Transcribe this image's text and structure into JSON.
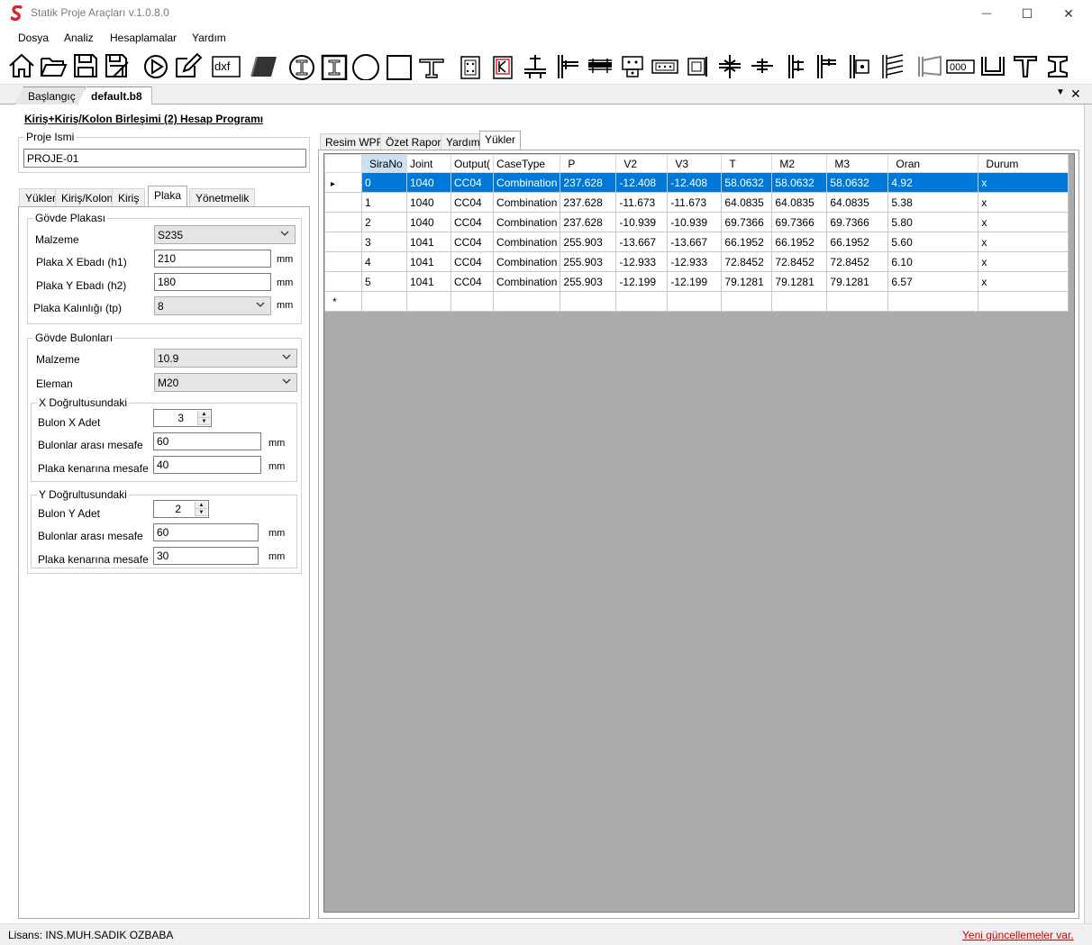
{
  "app": {
    "title": "Statik Proje Araçları v.1.0.8.0"
  },
  "menu": [
    "Dosya",
    "Analiz",
    "Hesaplamalar",
    "Yardım"
  ],
  "doc_tabs": [
    {
      "label": "Başlangıç"
    },
    {
      "label": "default.b8"
    }
  ],
  "program_title": "Kiriş+Kiriş/Kolon Birleşimi (2) Hesap Programı",
  "project": {
    "label": "Proje Ismi",
    "value": "PROJE-01"
  },
  "left_tabs": [
    "Yükler",
    "Kiriş/Kolon",
    "Kiriş",
    "Plaka",
    "Yönetmelik"
  ],
  "govde_plakasi": {
    "title": "Gövde Plakası",
    "malzeme_label": "Malzeme",
    "malzeme_value": "S235",
    "h1_label": "Plaka X Ebadı (h1)",
    "h1_value": "210",
    "h2_label": "Plaka Y Ebadı (h2)",
    "h2_value": "180",
    "tp_label": "Plaka Kalınlığı (tp)",
    "tp_value": "8",
    "unit": "mm"
  },
  "govde_bulonlari": {
    "title": "Gövde Bulonları",
    "malzeme_label": "Malzeme",
    "malzeme_value": "10.9",
    "eleman_label": "Eleman",
    "eleman_value": "M20",
    "x_dir": {
      "title": "X Doğrultusundaki",
      "adet_label": "Bulon X Adet",
      "adet_value": "3",
      "mesafe_label": "Bulonlar arası mesafe",
      "mesafe_value": "60",
      "kenar_label": "Plaka kenarına mesafe",
      "kenar_value": "40"
    },
    "y_dir": {
      "title": "Y Doğrultusundaki",
      "adet_label": "Bulon Y Adet",
      "adet_value": "2",
      "mesafe_label": "Bulonlar arası mesafe",
      "mesafe_value": "60",
      "kenar_label": "Plaka kenarına mesafe",
      "kenar_value": "30"
    },
    "unit": "mm"
  },
  "right_tabs": [
    "Resim WPF",
    "Özet Rapor",
    "Yardım",
    "Yükler"
  ],
  "grid": {
    "columns": [
      "SiraNo",
      "Joint",
      "Output(",
      "CaseType",
      "P",
      "V2",
      "V3",
      "T",
      "M2",
      "M3",
      "Oran",
      "Durum"
    ],
    "rows": [
      [
        "0",
        "1040",
        "CC04",
        "Combination",
        "237.628",
        "-12.408",
        "-12.408",
        "58.0632",
        "58.0632",
        "58.0632",
        "4.92",
        "x"
      ],
      [
        "1",
        "1040",
        "CC04",
        "Combination",
        "237.628",
        "-11.673",
        "-11.673",
        "64.0835",
        "64.0835",
        "64.0835",
        "5.38",
        "x"
      ],
      [
        "2",
        "1040",
        "CC04",
        "Combination",
        "237.628",
        "-10.939",
        "-10.939",
        "69.7366",
        "69.7366",
        "69.7366",
        "5.80",
        "x"
      ],
      [
        "3",
        "1041",
        "CC04",
        "Combination",
        "255.903",
        "-13.667",
        "-13.667",
        "66.1952",
        "66.1952",
        "66.1952",
        "5.60",
        "x"
      ],
      [
        "4",
        "1041",
        "CC04",
        "Combination",
        "255.903",
        "-12.933",
        "-12.933",
        "72.8452",
        "72.8452",
        "72.8452",
        "6.10",
        "x"
      ],
      [
        "5",
        "1041",
        "CC04",
        "Combination",
        "255.903",
        "-12.199",
        "-12.199",
        "79.1281",
        "79.1281",
        "79.1281",
        "6.57",
        "x"
      ]
    ],
    "new_row_marker": "*",
    "selected_row_marker": "▸"
  },
  "status": {
    "license": "Lisans: INS.MUH.SADIK OZBABA",
    "update": "Yeni güncellemeler var."
  },
  "window_controls": {
    "minimize": "—",
    "maximize": "☐",
    "close": "✕"
  },
  "toolbar_icons": [
    "home-icon",
    "open-folder-icon",
    "save-icon",
    "save-as-icon",
    "run-icon",
    "edit-icon",
    "dxf-icon",
    "plate-icon",
    "i-section-circle-icon",
    "i-section-square-icon",
    "circle-section-icon",
    "square-section-icon",
    "t-beam-icon",
    "connection-1-icon",
    "connection-2-icon",
    "connection-3-icon",
    "connection-4-icon",
    "connection-5-icon",
    "connection-6-icon",
    "connection-7-icon",
    "connection-8-icon",
    "connection-9-icon",
    "connection-10-icon",
    "connection-11-icon",
    "connection-12-icon",
    "connection-13-icon",
    "connection-14-icon",
    "connection-15-icon",
    "connection-16-icon",
    "connection-17-icon",
    "u-section-icon",
    "t-section-icon",
    "i-section-icon"
  ],
  "toolbar_labels": {
    "dxf": "dxf",
    "bolts": "000"
  },
  "colors": {
    "selection": "#0078d7",
    "update_link": "#d00000",
    "grid_bg": "#ababab",
    "accent_red": "#d9232e"
  }
}
